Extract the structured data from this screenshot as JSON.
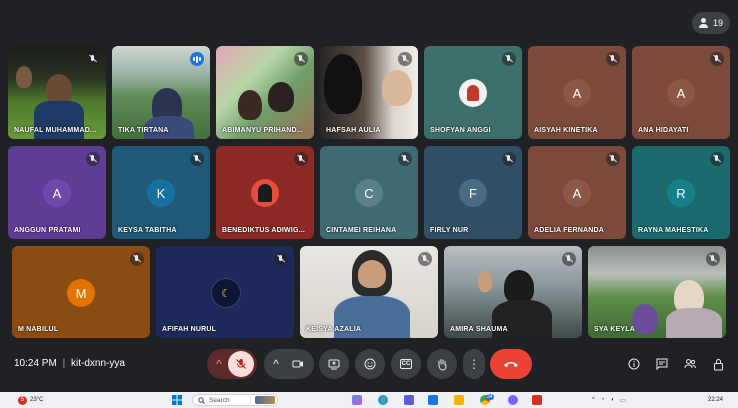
{
  "meeting": {
    "participant_count": "19",
    "time": "10:24 PM",
    "separator": "|",
    "code": "kit-dxnn-yya"
  },
  "tiles": [
    {
      "name": "NAUFAL MUHAMMAD...",
      "kind": "video",
      "mic": "muted"
    },
    {
      "name": "TIKA TIRTANA",
      "kind": "video",
      "mic": "speaking"
    },
    {
      "name": "ABIMANYU PRIHAND...",
      "kind": "video",
      "mic": "muted"
    },
    {
      "name": "HAFSAH AULIA",
      "kind": "video",
      "mic": "muted"
    },
    {
      "name": "SHOFYAN ANGGI",
      "kind": "photo",
      "mic": "muted"
    },
    {
      "name": "AISYAH KINETIKA",
      "kind": "letter",
      "letter": "A",
      "mic": "muted"
    },
    {
      "name": "ANA HIDAYATI",
      "kind": "letter",
      "letter": "A",
      "mic": "muted"
    },
    {
      "name": "ANGGUN PRATAMI",
      "kind": "letter",
      "letter": "A",
      "mic": "muted"
    },
    {
      "name": "KEYSA TABITHA",
      "kind": "letter",
      "letter": "K",
      "mic": "muted"
    },
    {
      "name": "BENEDIKTUS ADIWIG...",
      "kind": "photo",
      "mic": "muted"
    },
    {
      "name": "CINTAMEI REIHANA",
      "kind": "letter",
      "letter": "C",
      "mic": "muted"
    },
    {
      "name": "FIRLY NUR",
      "kind": "letter",
      "letter": "F",
      "mic": "muted"
    },
    {
      "name": "ADELIA FERNANDA",
      "kind": "letter",
      "letter": "A",
      "mic": "muted"
    },
    {
      "name": "RAYNA MAHESTIKA",
      "kind": "letter",
      "letter": "R",
      "mic": "muted"
    },
    {
      "name": "M NABILUL",
      "kind": "letter",
      "letter": "M",
      "mic": "muted"
    },
    {
      "name": "AFIFAH NURUL",
      "kind": "photo",
      "mic": "muted"
    },
    {
      "name": "KEISYA AZALIA",
      "kind": "video",
      "mic": "muted"
    },
    {
      "name": "AMIRA SHAUMA",
      "kind": "video",
      "mic": "muted"
    },
    {
      "name": "SYA KEYLA",
      "kind": "video",
      "mic": "muted"
    }
  ],
  "controls": {
    "more_audio": "^",
    "mic": "mic-off-icon",
    "more_video": "^",
    "camera": "camera-icon",
    "present": "present-icon",
    "emoji": "emoji-icon",
    "captions": "CC",
    "hand": "raise-hand-icon",
    "more": "⋮",
    "leave": "end-call-icon",
    "info": "info-icon",
    "chat": "chat-icon",
    "people": "people-icon",
    "lock": "lock-icon"
  },
  "taskbar": {
    "weather_badge": "5",
    "temperature": "23°C",
    "search_placeholder": "Search",
    "clock": "22:24",
    "notification_count": "34"
  },
  "colors": {
    "background": "#202124",
    "accent_blue": "#8ab4f8",
    "leave_red": "#ea4335"
  }
}
